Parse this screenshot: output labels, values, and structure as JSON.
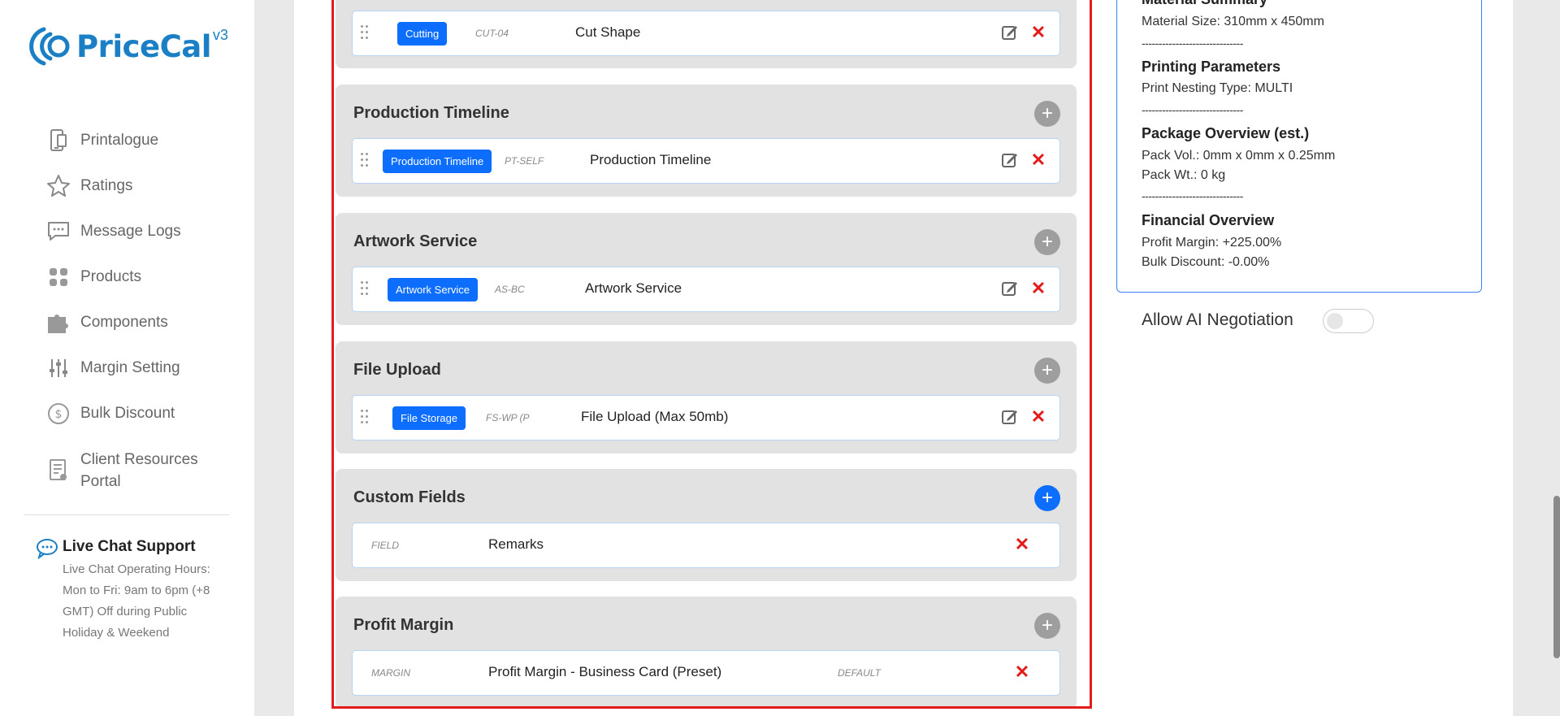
{
  "logo": {
    "text": "PriceCal",
    "version": "v3"
  },
  "nav": [
    {
      "label": "Printalogue",
      "icon": "phone-book-icon"
    },
    {
      "label": "Ratings",
      "icon": "star-icon"
    },
    {
      "label": "Message Logs",
      "icon": "message-icon"
    },
    {
      "label": "Products",
      "icon": "grid-icon"
    },
    {
      "label": "Components",
      "icon": "puzzle-icon"
    },
    {
      "label": "Margin Setting",
      "icon": "sliders-icon"
    },
    {
      "label": "Bulk Discount",
      "icon": "dollar-icon"
    },
    {
      "label": "Client Resources Portal",
      "icon": "document-icon"
    }
  ],
  "chat": {
    "title": "Live Chat Support",
    "body": "Live Chat Operating Hours: Mon to Fri: 9am to 6pm (+8 GMT) Off during Public Holiday & Weekend"
  },
  "sections": [
    {
      "title": "",
      "row": {
        "badge": "Cutting",
        "code": "CUT-04",
        "name": "Cut Shape"
      }
    },
    {
      "title": "Production Timeline",
      "row": {
        "badge": "Production Timeline",
        "code": "PT-SELF",
        "name": "Production Timeline"
      }
    },
    {
      "title": "Artwork Service",
      "row": {
        "badge": "Artwork Service",
        "code": "AS-BC",
        "name": "Artwork Service"
      }
    },
    {
      "title": "File Upload",
      "row": {
        "badge": "File Storage",
        "code": "FS-WP (P",
        "name": "File Upload (Max 50mb)"
      }
    },
    {
      "title": "Custom Fields",
      "row": {
        "code": "FIELD",
        "name": "Remarks"
      }
    },
    {
      "title": "Profit Margin",
      "row": {
        "code": "MARGIN",
        "name": "Profit Margin - Business Card (Preset)",
        "extra": "DEFAULT"
      }
    }
  ],
  "summary": {
    "material_heading": "Material Summary",
    "material_size": "Material Size: 310mm x 450mm",
    "divider": "------------------------------",
    "printing_heading": "Printing Parameters",
    "nesting": "Print Nesting Type: MULTI",
    "package_heading": "Package Overview (est.)",
    "pack_vol": "Pack Vol.: 0mm x 0mm x 0.25mm",
    "pack_wt": "Pack Wt.: 0 kg",
    "financial_heading": "Financial Overview",
    "profit_margin": "Profit Margin: +225.00%",
    "bulk_discount": "Bulk Discount: -0.00%"
  },
  "ai_negotiation": {
    "label": "Allow AI Negotiation",
    "enabled": false
  },
  "colors": {
    "accent": "#0d6efd",
    "brand": "#1a7fc4",
    "danger": "#e21b1b"
  }
}
